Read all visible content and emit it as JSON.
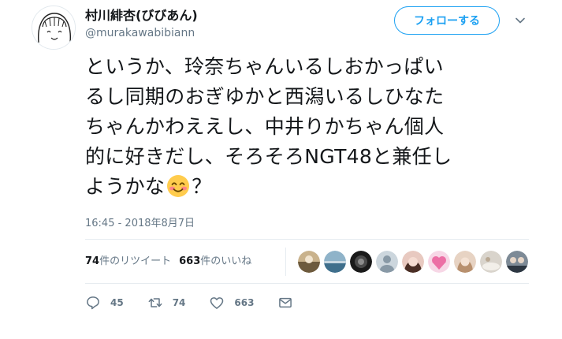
{
  "user": {
    "display_name": "村川緋杏(びびあん)",
    "screen_name": "@murakawabibiann"
  },
  "follow_label": "フォローする",
  "tweet": {
    "lines": [
      "というか、玲奈ちゃんいるしおかっぱい",
      "るし同期のおぎゆかと西潟いるしひなた",
      "ちゃんかわええし、中井りかちゃん個人",
      "的に好きだし、そろそろNGT48と兼任し",
      "ようかな"
    ],
    "line5_suffix": "？",
    "emoji": "smiling-face-with-smiling-eyes"
  },
  "timestamp": "16:45 - 2018年8月7日",
  "stats": {
    "retweets_count": "74",
    "retweets_label": "件のリツイート",
    "likes_count": "663",
    "likes_label": "件のいいね"
  },
  "actions": {
    "replies": "45",
    "retweets": "74",
    "likes": "663"
  },
  "colors": {
    "accent": "#1da1f2",
    "secondary_text": "#657786",
    "divider": "#e6ecf0"
  },
  "icons": [
    "reply-icon",
    "retweet-icon",
    "like-icon",
    "message-icon",
    "chevron-down-icon"
  ]
}
